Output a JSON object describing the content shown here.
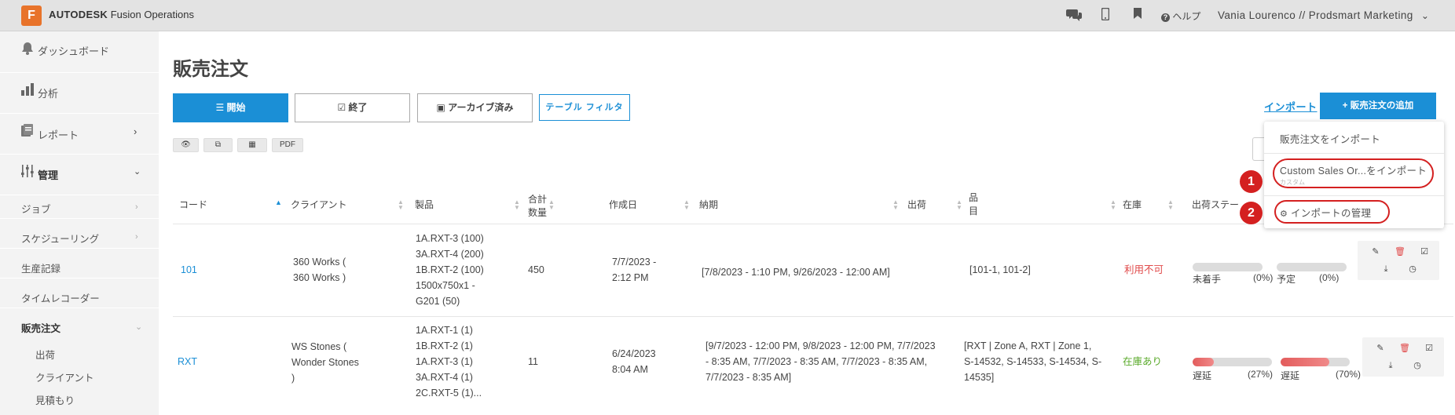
{
  "topbar": {
    "logo_letter": "F",
    "brand_bold": "AUTODESK",
    "brand_rest": " Fusion Operations",
    "icons": [
      "chat-icon",
      "mobile-icon",
      "bookmark-icon"
    ],
    "help_label": "ヘルプ",
    "user_label": "Vania Lourenco // Prodsmart Marketing"
  },
  "sidebar": {
    "dashboard": "ダッシュボード",
    "analytics": "分析",
    "reports": "レポート",
    "manage": "管理",
    "jobs": "ジョブ",
    "scheduling": "スケジューリング",
    "production_records": "生産記録",
    "time_recorder": "タイムレコーダー",
    "sales_orders": "販売注文",
    "shipping": "出荷",
    "clients": "クライアント",
    "quotes": "見積もり"
  },
  "main": {
    "title": "販売注文",
    "tabs": {
      "open": "開始",
      "closed": "終了",
      "archived": "アーカイブ済み"
    },
    "table_filter": "テーブル フィルタ",
    "view_buttons": {
      "pdf": "PDF"
    },
    "import_link": "インポート",
    "add_button": "販売注文の追加"
  },
  "dropdown": {
    "import_sales_orders": "販売注文をインポート",
    "import_custom": "Custom Sales Or...をインポート",
    "import_custom_sub": "カスタム",
    "manage_imports": "インポートの管理",
    "badge1": "1",
    "badge2": "2"
  },
  "table": {
    "headers": {
      "code": "コード",
      "client": "クライアント",
      "products": "製品",
      "total_qty_1": "合計",
      "total_qty_2": "数量",
      "created": "作成日",
      "delivery": "納期",
      "shipping": "出荷",
      "items_1": "品",
      "items_2": "目",
      "stock": "在庫",
      "ship_status": "出荷ステー"
    },
    "rows": [
      {
        "code": "101",
        "client_1": "360 Works (",
        "client_2": "360 Works )",
        "products": [
          "1A.RXT-3 (100)",
          "3A.RXT-4 (200)",
          "1B.RXT-2 (100)",
          "1500x750x1 -",
          "G201 (50)"
        ],
        "qty": "450",
        "created_1": "7/7/2023 -",
        "created_2": "2:12 PM",
        "delivery": "[7/8/2023 - 1:10 PM, 9/26/2023 - 12:00 AM]",
        "items": "[101-1, 101-2]",
        "stock": "利用不可",
        "status1_label": "未着手",
        "status1_pct": "(0%)",
        "status1_value": 0,
        "status2_label": "予定",
        "status2_pct": "(0%)",
        "status2_value": 0
      },
      {
        "code": "RXT",
        "client_1": "WS Stones (",
        "client_2": "Wonder Stones",
        "client_3": ")",
        "products": [
          "1A.RXT-1 (1)",
          "1B.RXT-2 (1)",
          "1A.RXT-3 (1)",
          "3A.RXT-4 (1)",
          "2C.RXT-5 (1)..."
        ],
        "qty": "11",
        "created_1": "6/24/2023",
        "created_2": "8:04 AM",
        "delivery_lines": [
          "[9/7/2023 - 12:00 PM, 9/8/2023 - 12:00 PM, 7/7/2023",
          "- 8:35 AM, 7/7/2023 - 8:35 AM, 7/7/2023 - 8:35 AM,",
          "7/7/2023 - 8:35 AM]"
        ],
        "items_lines": [
          "[RXT | Zone A, RXT | Zone 1,",
          "S-14532, S-14533, S-14534, S-",
          "14535]"
        ],
        "stock": "在庫あり",
        "status1_label": "遅延",
        "status1_pct": "(27%)",
        "status1_value": 27,
        "status2_label": "遅延",
        "status2_pct": "(70%)",
        "status2_value": 70
      }
    ]
  },
  "colors": {
    "accent": "#1b8fd6",
    "brand_orange": "#e8732a",
    "highlight_red": "#d42020"
  }
}
